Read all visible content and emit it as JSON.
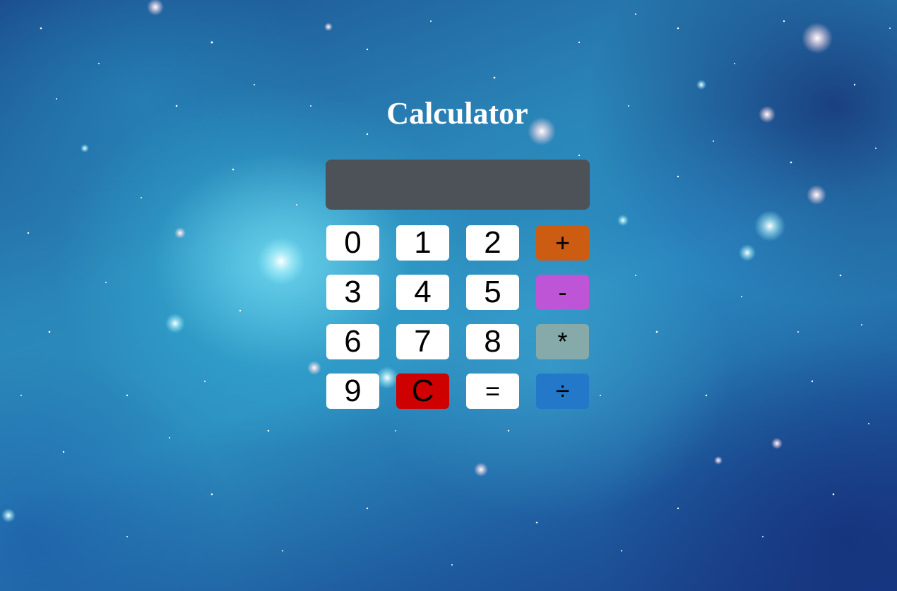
{
  "title": "Calculator",
  "display": {
    "value": ""
  },
  "keys": {
    "k0": "0",
    "k1": "1",
    "k2": "2",
    "plus": "+",
    "k3": "3",
    "k4": "4",
    "k5": "5",
    "minus": "-",
    "k6": "6",
    "k7": "7",
    "k8": "8",
    "multiply": "*",
    "k9": "9",
    "clear": "C",
    "equals": "=",
    "divide": "÷"
  },
  "colors": {
    "display_bg": "#4c5257",
    "plus": "#cc5c12",
    "minus": "#be54d6",
    "multiply": "#86a9aa",
    "divide": "#2378c9",
    "clear": "#cf0000",
    "digit": "#ffffff"
  },
  "background": "starry-galaxy-nebula"
}
